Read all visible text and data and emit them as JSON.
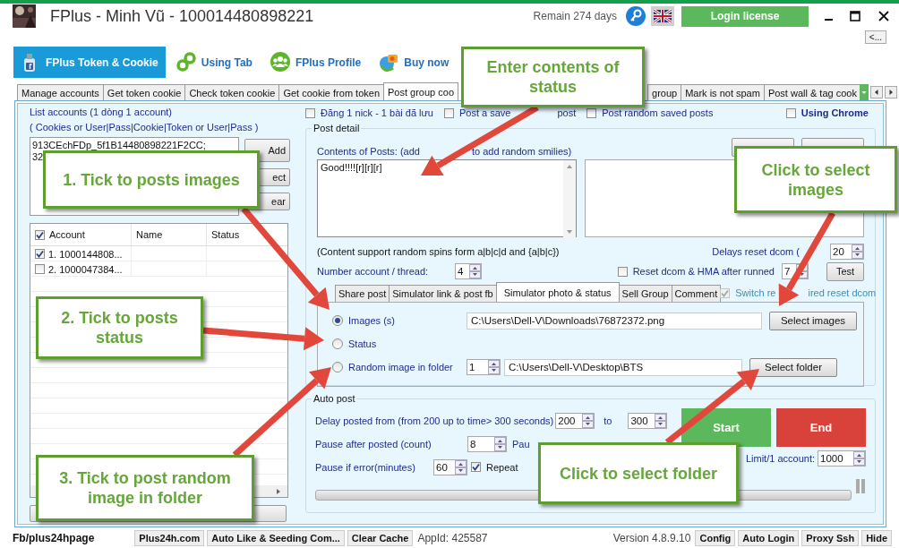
{
  "window": {
    "title": "FPlus - Minh Vũ - 100014480898221",
    "remaining": "Remain 274 days",
    "login_button": "Login license",
    "expand_button": "<..."
  },
  "main_tabs": [
    {
      "label": "FPlus Token & Cookie",
      "selected": true
    },
    {
      "label": "Using Tab",
      "selected": false
    },
    {
      "label": "FPlus Profile",
      "selected": false
    },
    {
      "label": "Buy now",
      "selected": false
    }
  ],
  "sub_tabs": [
    {
      "label": "Manage accounts",
      "selected": false
    },
    {
      "label": "Get token cookie",
      "selected": false
    },
    {
      "label": "Check token cookie",
      "selected": false
    },
    {
      "label": "Get cookie from token",
      "selected": false
    },
    {
      "label": "Post group coo",
      "selected": true
    },
    {
      "label": "group",
      "selected": false
    },
    {
      "label": "Mark is not spam",
      "selected": false
    },
    {
      "label": "Post wall & tag cook",
      "selected": false
    }
  ],
  "accounts": {
    "title": "List accounts (1 dòng 1 account)",
    "hint": "( Cookies or User|Pass|Cookie|Token or User|Pass )",
    "input_lines": [
      "913CEchFDp_5f1B14480898221F2CC;",
      "32"
    ],
    "buttons": [
      "Add",
      "ect",
      "ear"
    ],
    "all_checked": true,
    "columns": [
      "Account",
      "Name",
      "Status"
    ],
    "rows": [
      {
        "account": "1. 1000144808...",
        "checked": true
      },
      {
        "account": "2. 1000047384...",
        "checked": false
      }
    ]
  },
  "options": [
    {
      "label": "Đăng 1 nick - 1 bài đã lưu",
      "checked": false
    },
    {
      "label_parts": [
        "Post a save",
        "post"
      ],
      "checked": false
    },
    {
      "label": "Post random saved posts",
      "checked": false
    }
  ],
  "using_chrome": {
    "label": "Using Chrome",
    "checked": false
  },
  "post_detail": {
    "title": "Post detail",
    "contents_label_parts": [
      "Contents of Posts: (add",
      "to add random smilies)"
    ],
    "content": "Good!!!![r][r][r]",
    "spin_note": "(Content support random spins form a|b|c|d and {a|b|c})",
    "delays_label": "Delays reset dcom (",
    "delays_value": "20",
    "threads_label": "Number account / thread:",
    "threads_value": "4",
    "reset_label": "Reset dcom & HMA after runned",
    "reset_checked": false,
    "reset_value": "7",
    "test_button": "Test"
  },
  "post_tabs": [
    {
      "label": "Share post",
      "selected": false
    },
    {
      "label": "Simulator link & post fb",
      "selected": false
    },
    {
      "label": "Simulator photo & status",
      "selected": true
    },
    {
      "label": "Sell Group",
      "selected": false
    },
    {
      "label": "Comment",
      "selected": false
    }
  ],
  "switch_reset": {
    "label_parts": [
      "Switch re",
      "ired reset dcom"
    ],
    "checked": true,
    "disabled": true
  },
  "sources": [
    {
      "kind": "file",
      "label": "Images (s)",
      "selected": true,
      "path": "C:\\Users\\Dell-V\\Downloads\\76872372.png",
      "button": "Select images"
    },
    {
      "kind": "plain",
      "label": "Status",
      "selected": false
    },
    {
      "kind": "folder",
      "label": "Random image in folder",
      "selected": false,
      "count": "1",
      "path": "C:\\Users\\Dell-V\\Desktop\\BTS",
      "button": "Select folder"
    }
  ],
  "auto_post": {
    "title": "Auto post",
    "delay_label": "Delay posted from (from 200 up to time> 300 seconds)",
    "delay_from": "200",
    "to_label": "to",
    "delay_to": "300",
    "pause_count_label": "Pause after posted (count)",
    "pause_count": "8",
    "pause_label": "Pau",
    "error_label": "Pause if error(minutes)",
    "error_minutes": "60",
    "repeat_label": "Repeat",
    "repeat_checked": true,
    "limit_label": "Limit/1 account:",
    "limit": "1000",
    "start": "Start",
    "end": "End",
    "progress": {
      "level": 0
    }
  },
  "status_bar": {
    "page": "Fb/plus24hpage",
    "buttons_left": [
      "Plus24h.com",
      "Auto Like & Seeding Com...",
      "Clear Cache"
    ],
    "app_id": "AppId: 425587",
    "version": "Version 4.8.9.10",
    "buttons_right": [
      "Config",
      "Auto Login",
      "Proxy Ssh",
      "Hide"
    ]
  },
  "callouts": [
    "Enter contents of status",
    "1. Tick to posts images",
    "Click to select images",
    "2. Tick to posts status",
    "3. Tick to post random image in folder",
    "Click to select folder"
  ]
}
